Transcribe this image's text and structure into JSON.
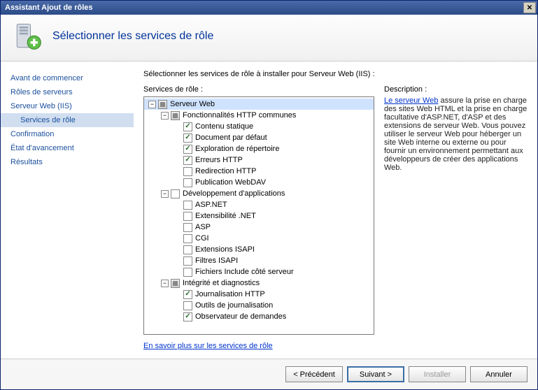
{
  "window": {
    "title": "Assistant Ajout de rôles"
  },
  "header": {
    "title": "Sélectionner les services de rôle"
  },
  "sidebar": {
    "items": [
      {
        "label": "Avant de commencer",
        "selected": false,
        "indent": false
      },
      {
        "label": "Rôles de serveurs",
        "selected": false,
        "indent": false
      },
      {
        "label": "Serveur Web (IIS)",
        "selected": false,
        "indent": false
      },
      {
        "label": "Services de rôle",
        "selected": true,
        "indent": true
      },
      {
        "label": "Confirmation",
        "selected": false,
        "indent": false
      },
      {
        "label": "État d'avancement",
        "selected": false,
        "indent": false
      },
      {
        "label": "Résultats",
        "selected": false,
        "indent": false
      }
    ]
  },
  "main": {
    "intro": "Sélectionner les services de rôle à installer pour Serveur Web (IIS) :",
    "tree_label": "Services de rôle :",
    "learn_more": "En savoir plus sur les services de rôle"
  },
  "tree": [
    {
      "depth": 0,
      "expander": "-",
      "check": "tri",
      "label": "Serveur Web",
      "selected": true
    },
    {
      "depth": 1,
      "expander": "-",
      "check": "tri",
      "label": "Fonctionnalités HTTP communes"
    },
    {
      "depth": 2,
      "expander": "",
      "check": "checked",
      "label": "Contenu statique"
    },
    {
      "depth": 2,
      "expander": "",
      "check": "checked",
      "label": "Document par défaut"
    },
    {
      "depth": 2,
      "expander": "",
      "check": "checked",
      "label": "Exploration de répertoire"
    },
    {
      "depth": 2,
      "expander": "",
      "check": "checked",
      "label": "Erreurs HTTP"
    },
    {
      "depth": 2,
      "expander": "",
      "check": "unchecked",
      "label": "Redirection HTTP"
    },
    {
      "depth": 2,
      "expander": "",
      "check": "unchecked",
      "label": "Publication WebDAV"
    },
    {
      "depth": 1,
      "expander": "-",
      "check": "unchecked",
      "label": "Développement d'applications"
    },
    {
      "depth": 2,
      "expander": "",
      "check": "unchecked",
      "label": "ASP.NET"
    },
    {
      "depth": 2,
      "expander": "",
      "check": "unchecked",
      "label": "Extensibilité .NET"
    },
    {
      "depth": 2,
      "expander": "",
      "check": "unchecked",
      "label": "ASP"
    },
    {
      "depth": 2,
      "expander": "",
      "check": "unchecked",
      "label": "CGI"
    },
    {
      "depth": 2,
      "expander": "",
      "check": "unchecked",
      "label": "Extensions ISAPI"
    },
    {
      "depth": 2,
      "expander": "",
      "check": "unchecked",
      "label": "Filtres ISAPI"
    },
    {
      "depth": 2,
      "expander": "",
      "check": "unchecked",
      "label": "Fichiers Include côté serveur"
    },
    {
      "depth": 1,
      "expander": "-",
      "check": "tri",
      "label": "Intégrité et diagnostics"
    },
    {
      "depth": 2,
      "expander": "",
      "check": "checked",
      "label": "Journalisation HTTP"
    },
    {
      "depth": 2,
      "expander": "",
      "check": "unchecked",
      "label": "Outils de journalisation"
    },
    {
      "depth": 2,
      "expander": "",
      "check": "checked",
      "label": "Observateur de demandes"
    }
  ],
  "description": {
    "title": "Description :",
    "link_text": "Le serveur Web",
    "body": " assure la prise en charge des sites Web HTML et la prise en charge facultative d'ASP.NET, d'ASP et des extensions de serveur Web. Vous pouvez utiliser le serveur Web pour héberger un site Web interne ou externe ou pour fournir un environnement permettant aux développeurs de créer des applications Web."
  },
  "footer": {
    "prev": "< Précédent",
    "next": "Suivant >",
    "install": "Installer",
    "cancel": "Annuler"
  }
}
